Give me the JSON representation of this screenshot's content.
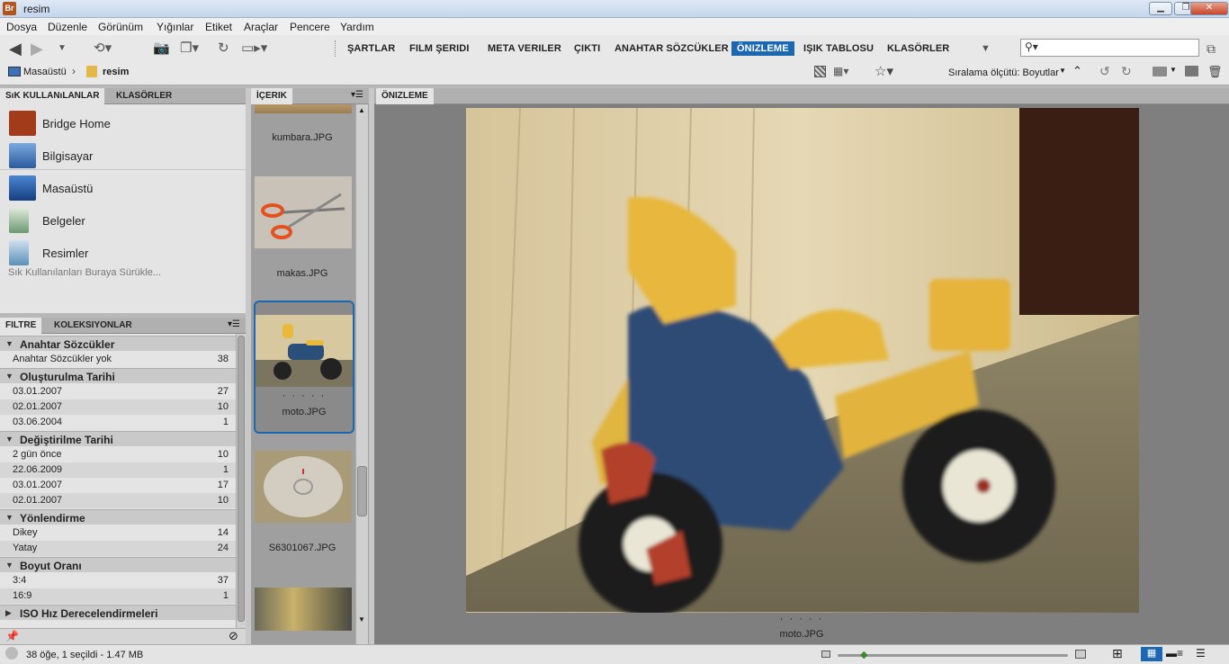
{
  "window": {
    "title": "resim",
    "app_icon": "Br"
  },
  "menu": [
    "Dosya",
    "Düzenle",
    "Görünüm",
    "Yığınlar",
    "Etiket",
    "Araçlar",
    "Pencere",
    "Yardım"
  ],
  "workspaces": [
    "ŞARTLAR",
    "FILM ŞERIDI",
    "META VERILER",
    "ÇIKTI",
    "ANAHTAR SÖZCÜKLER",
    "ÖNIZLEME",
    "IŞIK TABLOSU",
    "KLASÖRLER"
  ],
  "active_workspace": "ÖNIZLEME",
  "search": {
    "placeholder": "",
    "icon": "search-icon"
  },
  "path": {
    "items": [
      "Masaüstü",
      "resim"
    ]
  },
  "sort": {
    "label": "Sıralama ölçütü: Boyutlar"
  },
  "favorites": {
    "tabs": [
      "SıK KULLANıLANLAR",
      "KLASÖRLER"
    ],
    "items": [
      "Bridge Home",
      "Bilgisayar",
      "Masaüstü",
      "Belgeler",
      "Resimler"
    ],
    "hint": "Sık Kullanılanları Buraya Sürükle..."
  },
  "filter": {
    "tabs": [
      "FILTRE",
      "KOLEKSIYONLAR"
    ],
    "groups": [
      {
        "title": "Anahtar Sözcükler",
        "rows": [
          {
            "label": "Anahtar Sözcükler yok",
            "count": "38"
          }
        ]
      },
      {
        "title": "Oluşturulma Tarihi",
        "rows": [
          {
            "label": "03.01.2007",
            "count": "27"
          },
          {
            "label": "02.01.2007",
            "count": "10"
          },
          {
            "label": "03.06.2004",
            "count": "1"
          }
        ]
      },
      {
        "title": "Değiştirilme Tarihi",
        "rows": [
          {
            "label": "2 gün önce",
            "count": "10"
          },
          {
            "label": "22.06.2009",
            "count": "1"
          },
          {
            "label": "03.01.2007",
            "count": "17"
          },
          {
            "label": "02.01.2007",
            "count": "10"
          }
        ]
      },
      {
        "title": "Yönlendirme",
        "rows": [
          {
            "label": "Dikey",
            "count": "14"
          },
          {
            "label": "Yatay",
            "count": "24"
          }
        ]
      },
      {
        "title": "Boyut Oranı",
        "rows": [
          {
            "label": "3:4",
            "count": "37"
          },
          {
            "label": "16:9",
            "count": "1"
          }
        ]
      },
      {
        "title": "ISO Hız Derecelendirmeleri",
        "rows": []
      }
    ]
  },
  "content": {
    "tab": "İÇERIK",
    "items": [
      {
        "name": "kumbara.JPG"
      },
      {
        "name": "makas.JPG"
      },
      {
        "name": "moto.JPG",
        "stars": "· · · · ·"
      },
      {
        "name": "S6301067.JPG"
      }
    ]
  },
  "preview": {
    "tab": "ÖNIZLEME",
    "filename": "moto.JPG",
    "stars": "· · · · ·"
  },
  "status": {
    "text": "38 öğe, 1 seçildi - 1.47 MB"
  }
}
